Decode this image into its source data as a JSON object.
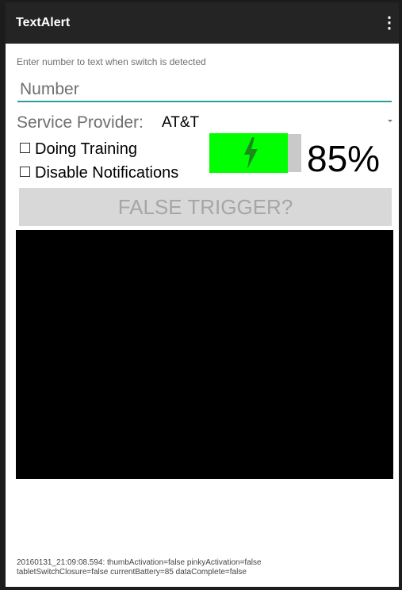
{
  "appbar": {
    "title": "TextAlert",
    "menu_icon": "overflow-menu-icon",
    "background": "#242424"
  },
  "form": {
    "hint": "Enter number to text when switch is detected",
    "number_placeholder": "Number",
    "number_value": "",
    "accent": "#2a9d9b",
    "provider_label": "Service Provider:",
    "provider_value": "AT&T",
    "doing_training_label": "Doing Training",
    "doing_training_checked": false,
    "disable_notifications_label": "Disable Notifications",
    "disable_notifications_checked": false
  },
  "battery": {
    "level": 0.85,
    "percent_label": "85%",
    "charging": true,
    "fill_color": "#00ff00",
    "icon": "lightning-bolt-icon"
  },
  "false_trigger": {
    "label": "FALSE TRIGGER?",
    "enabled": false
  },
  "status": {
    "line1": "20160131_21:09:08.594: thumbActivation=false pinkyActivation=false",
    "line2": "tabletSwitchClosure=false currentBattery=85 dataComplete=false"
  }
}
